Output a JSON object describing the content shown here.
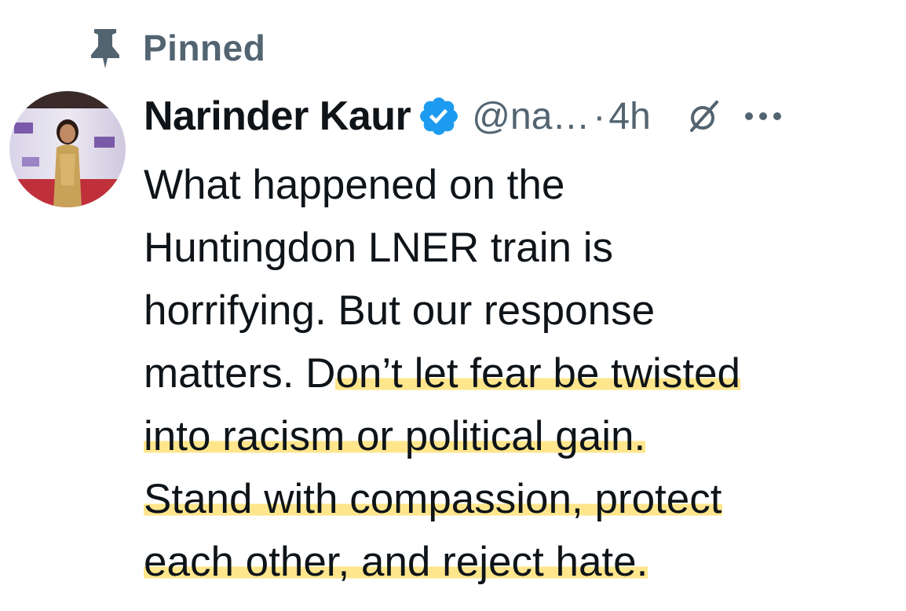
{
  "pinned": {
    "icon": "pin-icon",
    "label": "Pinned"
  },
  "author": {
    "avatar": "avatar",
    "display_name": "Narinder Kaur",
    "verified_icon": "verified-badge-icon",
    "verified_color": "#1d9bf0",
    "handle": "@na…",
    "separator": "·",
    "time": "4h"
  },
  "actions": {
    "grok_icon": "grok-icon",
    "more_icon": "more-icon"
  },
  "tweet": {
    "lines": [
      {
        "plain": "What happened on the",
        "highlight": ""
      },
      {
        "plain": "Huntingdon LNER train is",
        "highlight": ""
      },
      {
        "plain": "horrifying. But our response",
        "highlight": ""
      },
      {
        "plain": "matters. D",
        "highlight": "on’t let fear be twisted"
      },
      {
        "plain": "",
        "highlight": "into racism or political gain."
      },
      {
        "plain": "",
        "highlight": "Stand with compassion, protect"
      },
      {
        "plain": "",
        "highlight": "each other, and reject hate."
      }
    ]
  },
  "colors": {
    "text_primary": "#0f1419",
    "text_secondary": "#536471",
    "highlight": "#ffde66"
  }
}
